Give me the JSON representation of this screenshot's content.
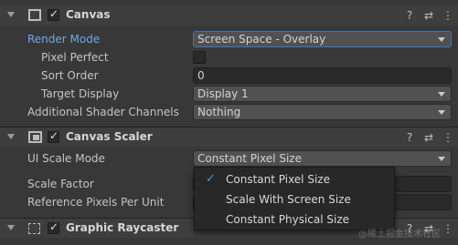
{
  "canvas": {
    "title": "Canvas",
    "rows": [
      {
        "label": "Render Mode",
        "value": "Screen Space - Overlay"
      },
      {
        "label": "Pixel Perfect",
        "value": ""
      },
      {
        "label": "Sort Order",
        "value": "0"
      },
      {
        "label": "Target Display",
        "value": "Display 1"
      },
      {
        "label": "Additional Shader Channels",
        "value": "Nothing"
      }
    ]
  },
  "canvas_scaler": {
    "title": "Canvas Scaler",
    "rows": [
      {
        "label": "UI Scale Mode",
        "value": "Constant Pixel Size"
      },
      {
        "label": "Scale Factor",
        "value": ""
      },
      {
        "label": "Reference Pixels Per Unit",
        "value": ""
      }
    ]
  },
  "graphic_raycaster": {
    "title": "Graphic Raycaster"
  },
  "popup": {
    "items": [
      {
        "label": "Constant Pixel Size",
        "checked": true
      },
      {
        "label": "Scale With Screen Size",
        "checked": false
      },
      {
        "label": "Constant Physical Size",
        "checked": false
      }
    ],
    "check_glyph": "✓"
  },
  "header_icons": {
    "help": "?",
    "presets": "⇄",
    "menu": "⋮"
  },
  "watermark": "@稀土掘金技术社区",
  "colors": {
    "accent": "#4f98e3",
    "highlight_label": "#6aa8e8"
  }
}
